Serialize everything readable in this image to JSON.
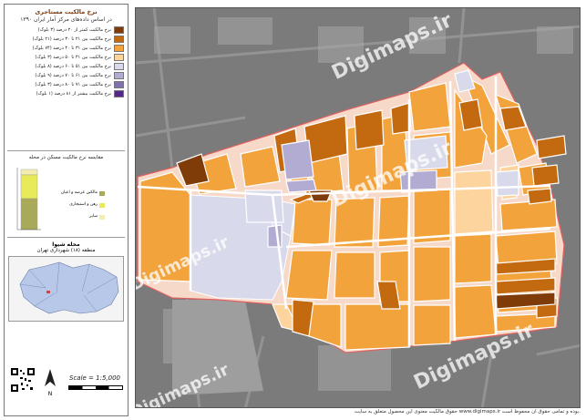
{
  "legend": {
    "title": "نرخ مالکیت مستاجری",
    "subtitle": "در اساس داده‌های مرکز آمار ایران ۱۳۹۰",
    "items": [
      {
        "label": "نرخ مالکیت کمتر از ۲۰ درصد (۳ بلوک)",
        "color": "#7f3b08"
      },
      {
        "label": "نرخ مالکیت بین ۲۱ تا ۳۰ درصد (۲۱ بلوک)",
        "color": "#c36a10"
      },
      {
        "label": "نرخ مالکیت بین ۳۱ تا ۴۰ درصد (۷۴ بلوک)",
        "color": "#f2a33c"
      },
      {
        "label": "نرخ مالکیت بین ۴۱ تا ۵۰ درصد (۳ بلوک)",
        "color": "#fdd49e"
      },
      {
        "label": "نرخ مالکیت بین ۵۱ تا ۶۰ درصد (۸ بلوک)",
        "color": "#d8daeb"
      },
      {
        "label": "نرخ مالکیت بین ۶۱ تا ۷۰ درصد (۹ بلوک)",
        "color": "#b2abd2"
      },
      {
        "label": "نرخ مالکیت بین ۷۱ تا ۸۰ درصد (۳ بلوک)",
        "color": "#8073ac"
      },
      {
        "label": "نرخ مالکیت بیشتر از ۸۱ درصد (۱ بلوک)",
        "color": "#542788"
      }
    ]
  },
  "chart": {
    "title": "مقایسه نرخ مالکیت مسکن در محله",
    "legend": [
      {
        "label": "مالکین عرصه و اعیان",
        "color": "#a9a95a"
      },
      {
        "label": "رهن و استیجاری",
        "color": "#e8ea5a"
      },
      {
        "label": "سایر",
        "color": "#f3eeb0"
      }
    ]
  },
  "location": {
    "neighborhood": "محله شیوا",
    "district": "منطقه (۱۸) شهرداری تهران"
  },
  "scale": "Scale = 1:5,000",
  "north": "N",
  "watermark": "Digimaps.ir",
  "footer": "حقوق مالکیت معنوی این محصول متعلق به سایت www.digimaps.ir بوده و تمامی حقوق آن محفوظ است."
}
